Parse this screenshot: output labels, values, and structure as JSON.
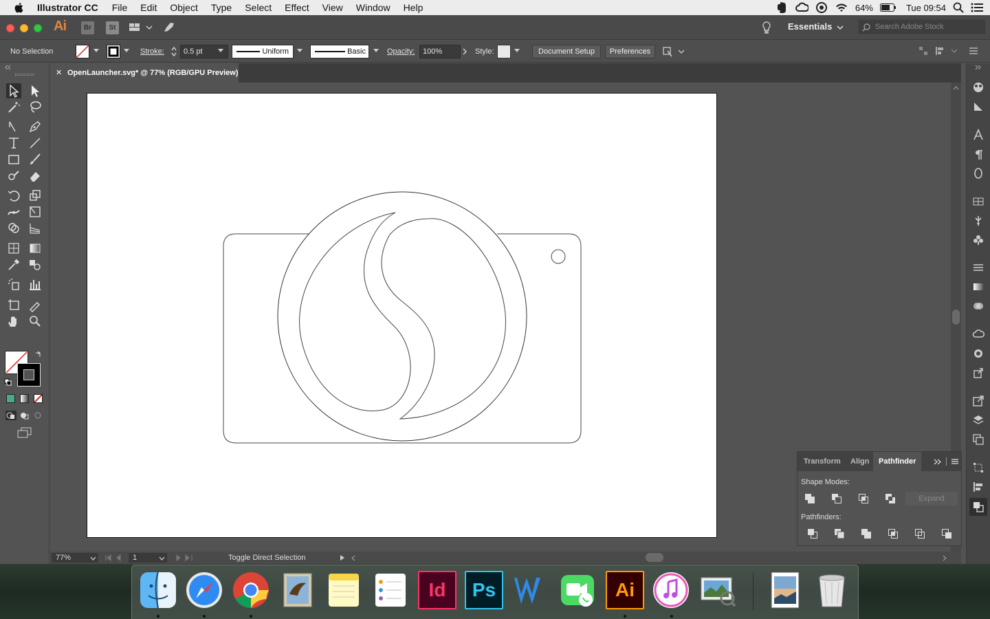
{
  "menubar": {
    "app_name": "Illustrator CC",
    "items": [
      "File",
      "Edit",
      "Object",
      "Type",
      "Select",
      "Effect",
      "View",
      "Window",
      "Help"
    ],
    "battery": "64%",
    "clock": "Tue 09:54"
  },
  "titlebar": {
    "logo": "Ai",
    "bridge": "Br",
    "stock": "St",
    "workspace": "Essentials",
    "search_placeholder": "Search Adobe Stock"
  },
  "control": {
    "selection": "No Selection",
    "stroke_label": "Stroke:",
    "stroke_value": "0.5 pt",
    "profile": "Uniform",
    "brush": "Basic",
    "opacity_label": "Opacity:",
    "opacity_value": "100%",
    "style_label": "Style:",
    "document_setup": "Document Setup",
    "preferences": "Preferences"
  },
  "document": {
    "tab_title": "OpenLauncher.svg* @ 77% (RGB/GPU Preview)"
  },
  "status": {
    "zoom": "77%",
    "artboard": "1",
    "tool_hint": "Toggle Direct Selection"
  },
  "panel": {
    "tabs": [
      "Transform",
      "Align",
      "Pathfinder"
    ],
    "active_tab": "Pathfinder",
    "shape_modes_label": "Shape Modes:",
    "pathfinders_label": "Pathfinders:",
    "expand": "Expand"
  },
  "dock": {
    "apps": [
      "Finder",
      "Safari",
      "Chrome",
      "Mail",
      "Notes",
      "Reminders",
      "InDesign",
      "Photoshop",
      "Word",
      "FaceTime",
      "Illustrator",
      "iTunes",
      "Preview",
      "Photos",
      "Trash"
    ],
    "indesign_label": "Id",
    "photoshop_label": "Ps",
    "illustrator_label": "Ai"
  },
  "colors": {
    "ai_orange": "#e3863a",
    "ui_dark": "#535353"
  }
}
